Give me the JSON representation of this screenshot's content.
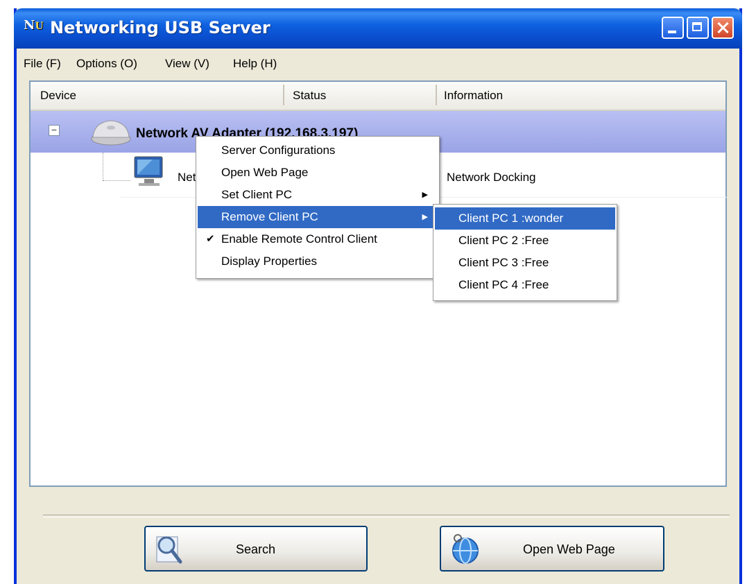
{
  "window": {
    "title": "Networking USB Server",
    "icon_text": "N",
    "icon_sub": "U",
    "controls": [
      "minimize-icon",
      "maximize-icon",
      "close-icon"
    ]
  },
  "menubar": {
    "items": [
      {
        "label": "File (F)"
      },
      {
        "label": "Options (O)"
      },
      {
        "label": "View (V)"
      },
      {
        "label": "Help (H)"
      }
    ]
  },
  "list": {
    "columns": [
      "Device",
      "Status",
      "Information"
    ],
    "device": {
      "expander": "−",
      "name": "Network AV Adapter  (192.168.3.197)",
      "icon": "router-icon"
    },
    "child": {
      "name": "Net",
      "information": "Network Docking",
      "icon": "monitor-icon"
    }
  },
  "context_menu": {
    "items": [
      {
        "label": "Server Configurations"
      },
      {
        "label": "Open Web Page"
      },
      {
        "label": "Set Client PC"
      },
      {
        "label": "Remove Client PC"
      },
      {
        "label": "Enable Remote Control Client"
      },
      {
        "label": "Display Properties"
      }
    ],
    "highlighted": "Remove Client PC",
    "checked": "Enable Remote Control Client",
    "check_glyph": "✔",
    "submenu_glyph": "▶"
  },
  "submenu": {
    "items": [
      {
        "label": "Client PC 1 :wonder"
      },
      {
        "label": "Client PC 2 :Free"
      },
      {
        "label": "Client PC 3 :Free"
      },
      {
        "label": "Client PC 4 :Free"
      }
    ],
    "highlighted": "Client PC 1 :wonder"
  },
  "buttons": {
    "search": {
      "label": "Search",
      "icon": "magnifier-icon"
    },
    "open_web": {
      "label": "Open Web Page",
      "icon": "globe-icon"
    }
  },
  "colors": {
    "title_bar": "#0a4fcf",
    "selection": "#316ac5",
    "row_highlight": "#9aa4e6",
    "window_face": "#ece9d8"
  }
}
